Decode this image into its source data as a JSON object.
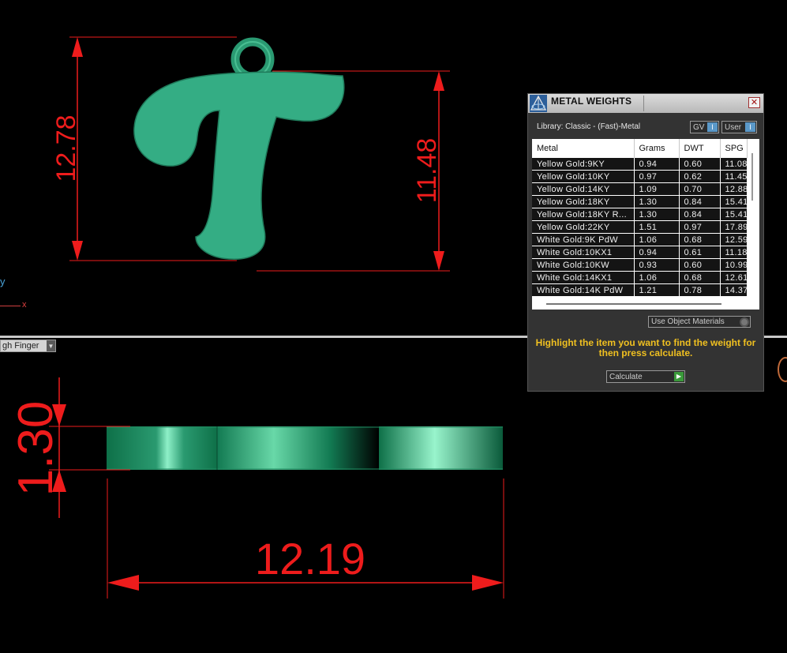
{
  "viewport_top": {
    "dim_height_total": "12.78",
    "dim_height_letter": "11.48",
    "axis_y_label": "y",
    "axis_x_label": "x"
  },
  "viewport_bottom": {
    "view_label": "gh Finger",
    "dim_thickness": "1.30",
    "dim_width": "12.19"
  },
  "panel": {
    "title": "METAL WEIGHTS",
    "close_glyph": "✕",
    "library_label": "Library: Classic - (Fast)-Metal",
    "toggle_gv": "GV",
    "toggle_user": "User",
    "toggle_glyph": "I",
    "columns": [
      "Metal",
      "Grams",
      "DWT",
      "SPG"
    ],
    "rows": [
      [
        "Yellow Gold:9KY",
        "0.94",
        "0.60",
        "11.08"
      ],
      [
        "Yellow Gold:10KY",
        "0.97",
        "0.62",
        "11.45"
      ],
      [
        "Yellow Gold:14KY",
        "1.09",
        "0.70",
        "12.88"
      ],
      [
        "Yellow Gold:18KY",
        "1.30",
        "0.84",
        "15.41"
      ],
      [
        "Yellow Gold:18KY R...",
        "1.30",
        "0.84",
        "15.41"
      ],
      [
        "Yellow Gold:22KY",
        "1.51",
        "0.97",
        "17.89"
      ],
      [
        "White Gold:9K PdW",
        "1.06",
        "0.68",
        "12.59"
      ],
      [
        "White Gold:10KX1",
        "0.94",
        "0.61",
        "11.18"
      ],
      [
        "White Gold:10KW",
        "0.93",
        "0.60",
        "10.99"
      ],
      [
        "White Gold:14KX1",
        "1.06",
        "0.68",
        "12.61"
      ],
      [
        "White Gold:14K PdW",
        "1.21",
        "0.78",
        "14.37"
      ]
    ],
    "use_object_materials": "Use Object Materials",
    "message": "Highlight the item you want to find the weight for then press calculate.",
    "calculate": "Calculate",
    "calculate_glyph": "▶"
  },
  "colors": {
    "background": "#000000",
    "dimension": "#ee1c1c",
    "pendant_green": "#34ad84",
    "panel_bg": "#333333",
    "message": "#f0c020"
  },
  "icons": [
    "app-logo-icon",
    "close-icon",
    "toggle-indicator-icon",
    "radio-indicator-icon",
    "play-arrow-icon",
    "dropdown-arrow-icon"
  ]
}
